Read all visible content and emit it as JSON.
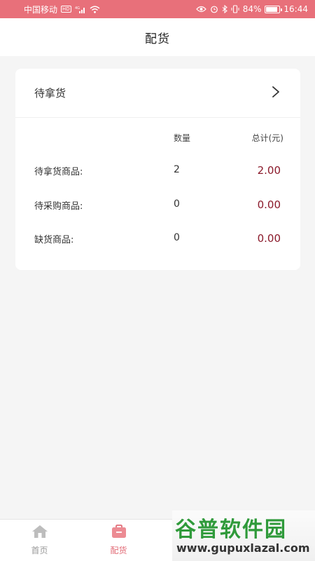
{
  "status_bar": {
    "carrier": "中国移动",
    "hd": "HD",
    "network": "4G",
    "battery": "84%",
    "battery_level": 0.84,
    "time": "16:44"
  },
  "header": {
    "title": "配货"
  },
  "card": {
    "title": "待拿货",
    "col_qty": "数量",
    "col_total": "总计(元)",
    "rows": [
      {
        "label": "待拿货商品:",
        "qty": "2",
        "total": "2.00"
      },
      {
        "label": "待采购商品:",
        "qty": "0",
        "total": "0.00"
      },
      {
        "label": "缺货商品:",
        "qty": "0",
        "total": "0.00"
      }
    ]
  },
  "tabs": [
    {
      "label": "首页",
      "icon": "home-icon",
      "active": false
    },
    {
      "label": "配货",
      "icon": "bag-icon",
      "active": true
    }
  ],
  "watermark": {
    "logo": "谷普软件园",
    "url": "www.gupuxlazal.com"
  },
  "colors": {
    "accent": "#e8707a",
    "amount": "#8b1a2b"
  }
}
